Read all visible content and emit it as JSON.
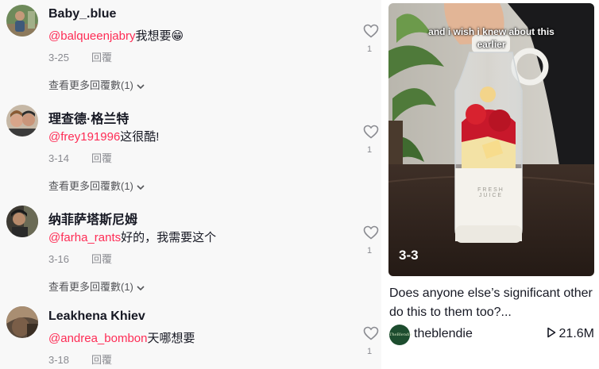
{
  "comments": [
    {
      "username": "Baby_.blue",
      "mention": "@balqueenjabry",
      "text": "我想要",
      "emoji": "😁",
      "date": "3-25",
      "reply_label": "回覆",
      "view_more": "查看更多回覆數(1)",
      "likes": "1"
    },
    {
      "username": "理查德·格兰特",
      "mention": "@frey191996",
      "text": "这很酷!",
      "date": "3-14",
      "reply_label": "回覆",
      "view_more": "查看更多回覆數(1)",
      "likes": "1"
    },
    {
      "username": "纳菲萨塔斯尼姆",
      "mention": "@farha_rants",
      "text": "好的，我需要这个",
      "date": "3-16",
      "reply_label": "回覆",
      "view_more": "查看更多回覆數(1)",
      "likes": "1"
    },
    {
      "username": "Leakhena Khiev",
      "mention": "@andrea_bombon",
      "text": "天哪想要",
      "date": "3-18",
      "reply_label": "回覆",
      "likes": "1"
    }
  ],
  "video": {
    "caption_line1": "and i wish i knew about this",
    "caption_line2": "earlier",
    "date_overlay": "3-3",
    "bottle_label_line1": "FRESH",
    "bottle_label_line2": "JUICE",
    "description": "Does anyone else’s significant other do this to them too?...",
    "author": "theblendie",
    "author_avatar_text": "TheBlendie",
    "plays": "21.6M"
  },
  "colors": {
    "mention": "#fe2c55",
    "meta": "#8a8b91",
    "comments_bg": "#f8f8f8"
  },
  "icons": [
    "heart-icon",
    "chevron-down-icon",
    "play-icon"
  ]
}
